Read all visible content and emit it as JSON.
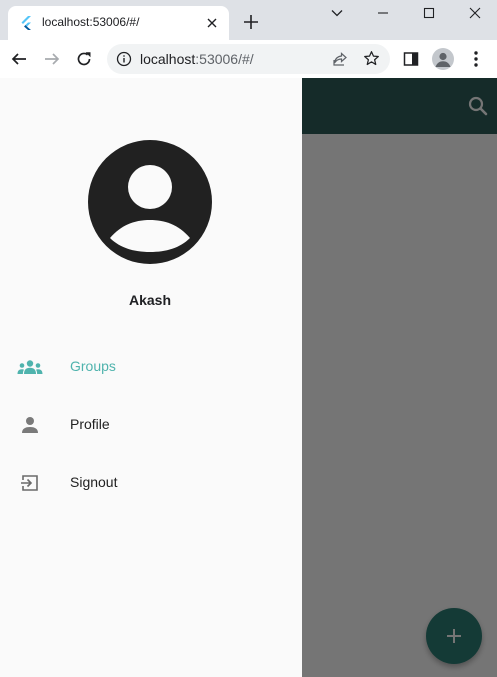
{
  "browser": {
    "tab": {
      "title": "localhost:53006/#/"
    },
    "address": {
      "host": "localhost",
      "rest": ":53006/#/"
    }
  },
  "drawer": {
    "user_name": "Akash",
    "items": [
      {
        "label": "Groups",
        "icon": "groups-icon",
        "active": true
      },
      {
        "label": "Profile",
        "icon": "person-icon",
        "active": false
      },
      {
        "label": "Signout",
        "icon": "logout-icon",
        "active": false
      }
    ]
  },
  "colors": {
    "appbar": "#2f5f5a",
    "accent": "#4fb3ad",
    "fab": "#2d7f76"
  }
}
